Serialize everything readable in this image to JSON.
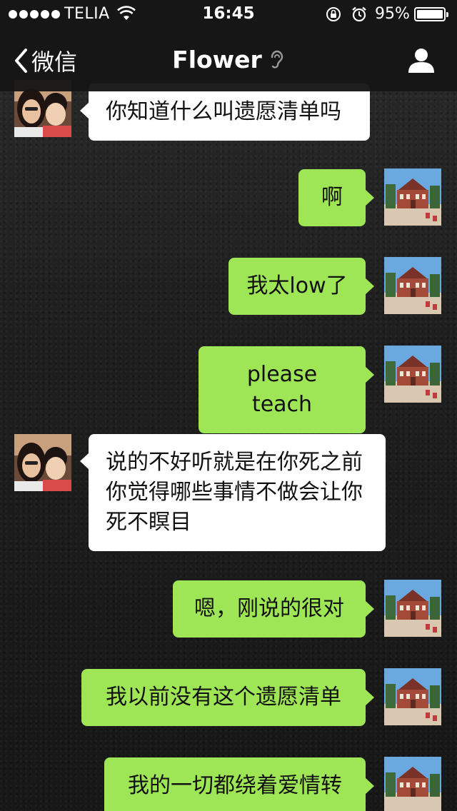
{
  "status_bar": {
    "carrier": "TELIA",
    "time": "16:45",
    "battery_percent": "95%",
    "battery_level": 0.95,
    "icons": [
      "signal-dots-icon",
      "wifi-icon",
      "rotation-lock-icon",
      "alarm-icon",
      "battery-icon"
    ]
  },
  "nav": {
    "back_label": "微信",
    "title": "Flower",
    "icons": [
      "chevron-left-icon",
      "earpiece-icon",
      "profile-icon"
    ]
  },
  "messages": [
    {
      "side": "in",
      "text": "你知道什么叫遗愿清单吗"
    },
    {
      "side": "out",
      "text": "啊"
    },
    {
      "side": "out",
      "text": "我太low了"
    },
    {
      "side": "out",
      "text": "please teach"
    },
    {
      "side": "in",
      "text": "说的不好听就是在你死之前你觉得哪些事情不做会让你死不瞑目"
    },
    {
      "side": "out",
      "text": "嗯，刚说的很对"
    },
    {
      "side": "out",
      "text": "我以前没有这个遗愿清单"
    },
    {
      "side": "out",
      "text": "我的一切都绕着爱情转"
    }
  ],
  "colors": {
    "outgoing_bubble": "#9fe657",
    "incoming_bubble": "#ffffff",
    "nav_background": "#161616"
  }
}
